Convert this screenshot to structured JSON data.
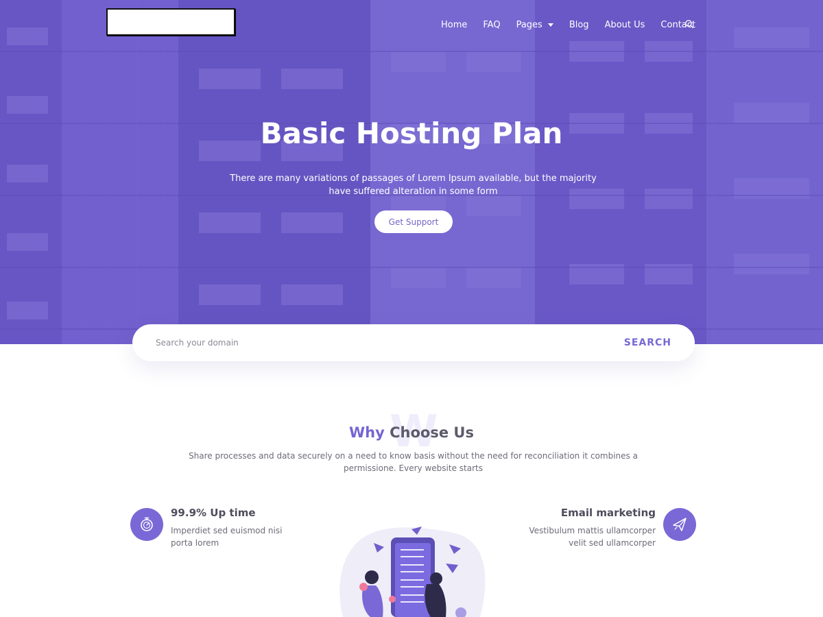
{
  "nav": {
    "items": [
      "Home",
      "FAQ",
      "Pages",
      "Blog",
      "About Us",
      "Contact"
    ],
    "search_icon": "search-icon"
  },
  "hero": {
    "title": "Basic Hosting Plan",
    "subtitle": "There are many variations of passages of Lorem Ipsum available, but the majority have suffered alteration in some form",
    "button_label": "Get Support"
  },
  "domain_search": {
    "placeholder": "Search your domain",
    "button_label": "SEARCH"
  },
  "why": {
    "bg_letter": "W",
    "title_accent": "Why",
    "title_rest": " Choose Us",
    "description": "Share processes and data securely on a need to know basis without the need for reconciliation it combines a permissione. Every website starts"
  },
  "features": [
    {
      "title": "99.9% Up time",
      "desc": "Imperdiet sed euismod nisi porta lorem",
      "icon": "stopwatch-icon"
    },
    {
      "title": "Email marketing",
      "desc": "Vestibulum mattis ullamcorper velit sed ullamcorper",
      "icon": "paper-plane-icon"
    }
  ],
  "colors": {
    "accent": "#7465d2",
    "hero_overlay": "#6f5ec6",
    "white": "#ffffff"
  }
}
